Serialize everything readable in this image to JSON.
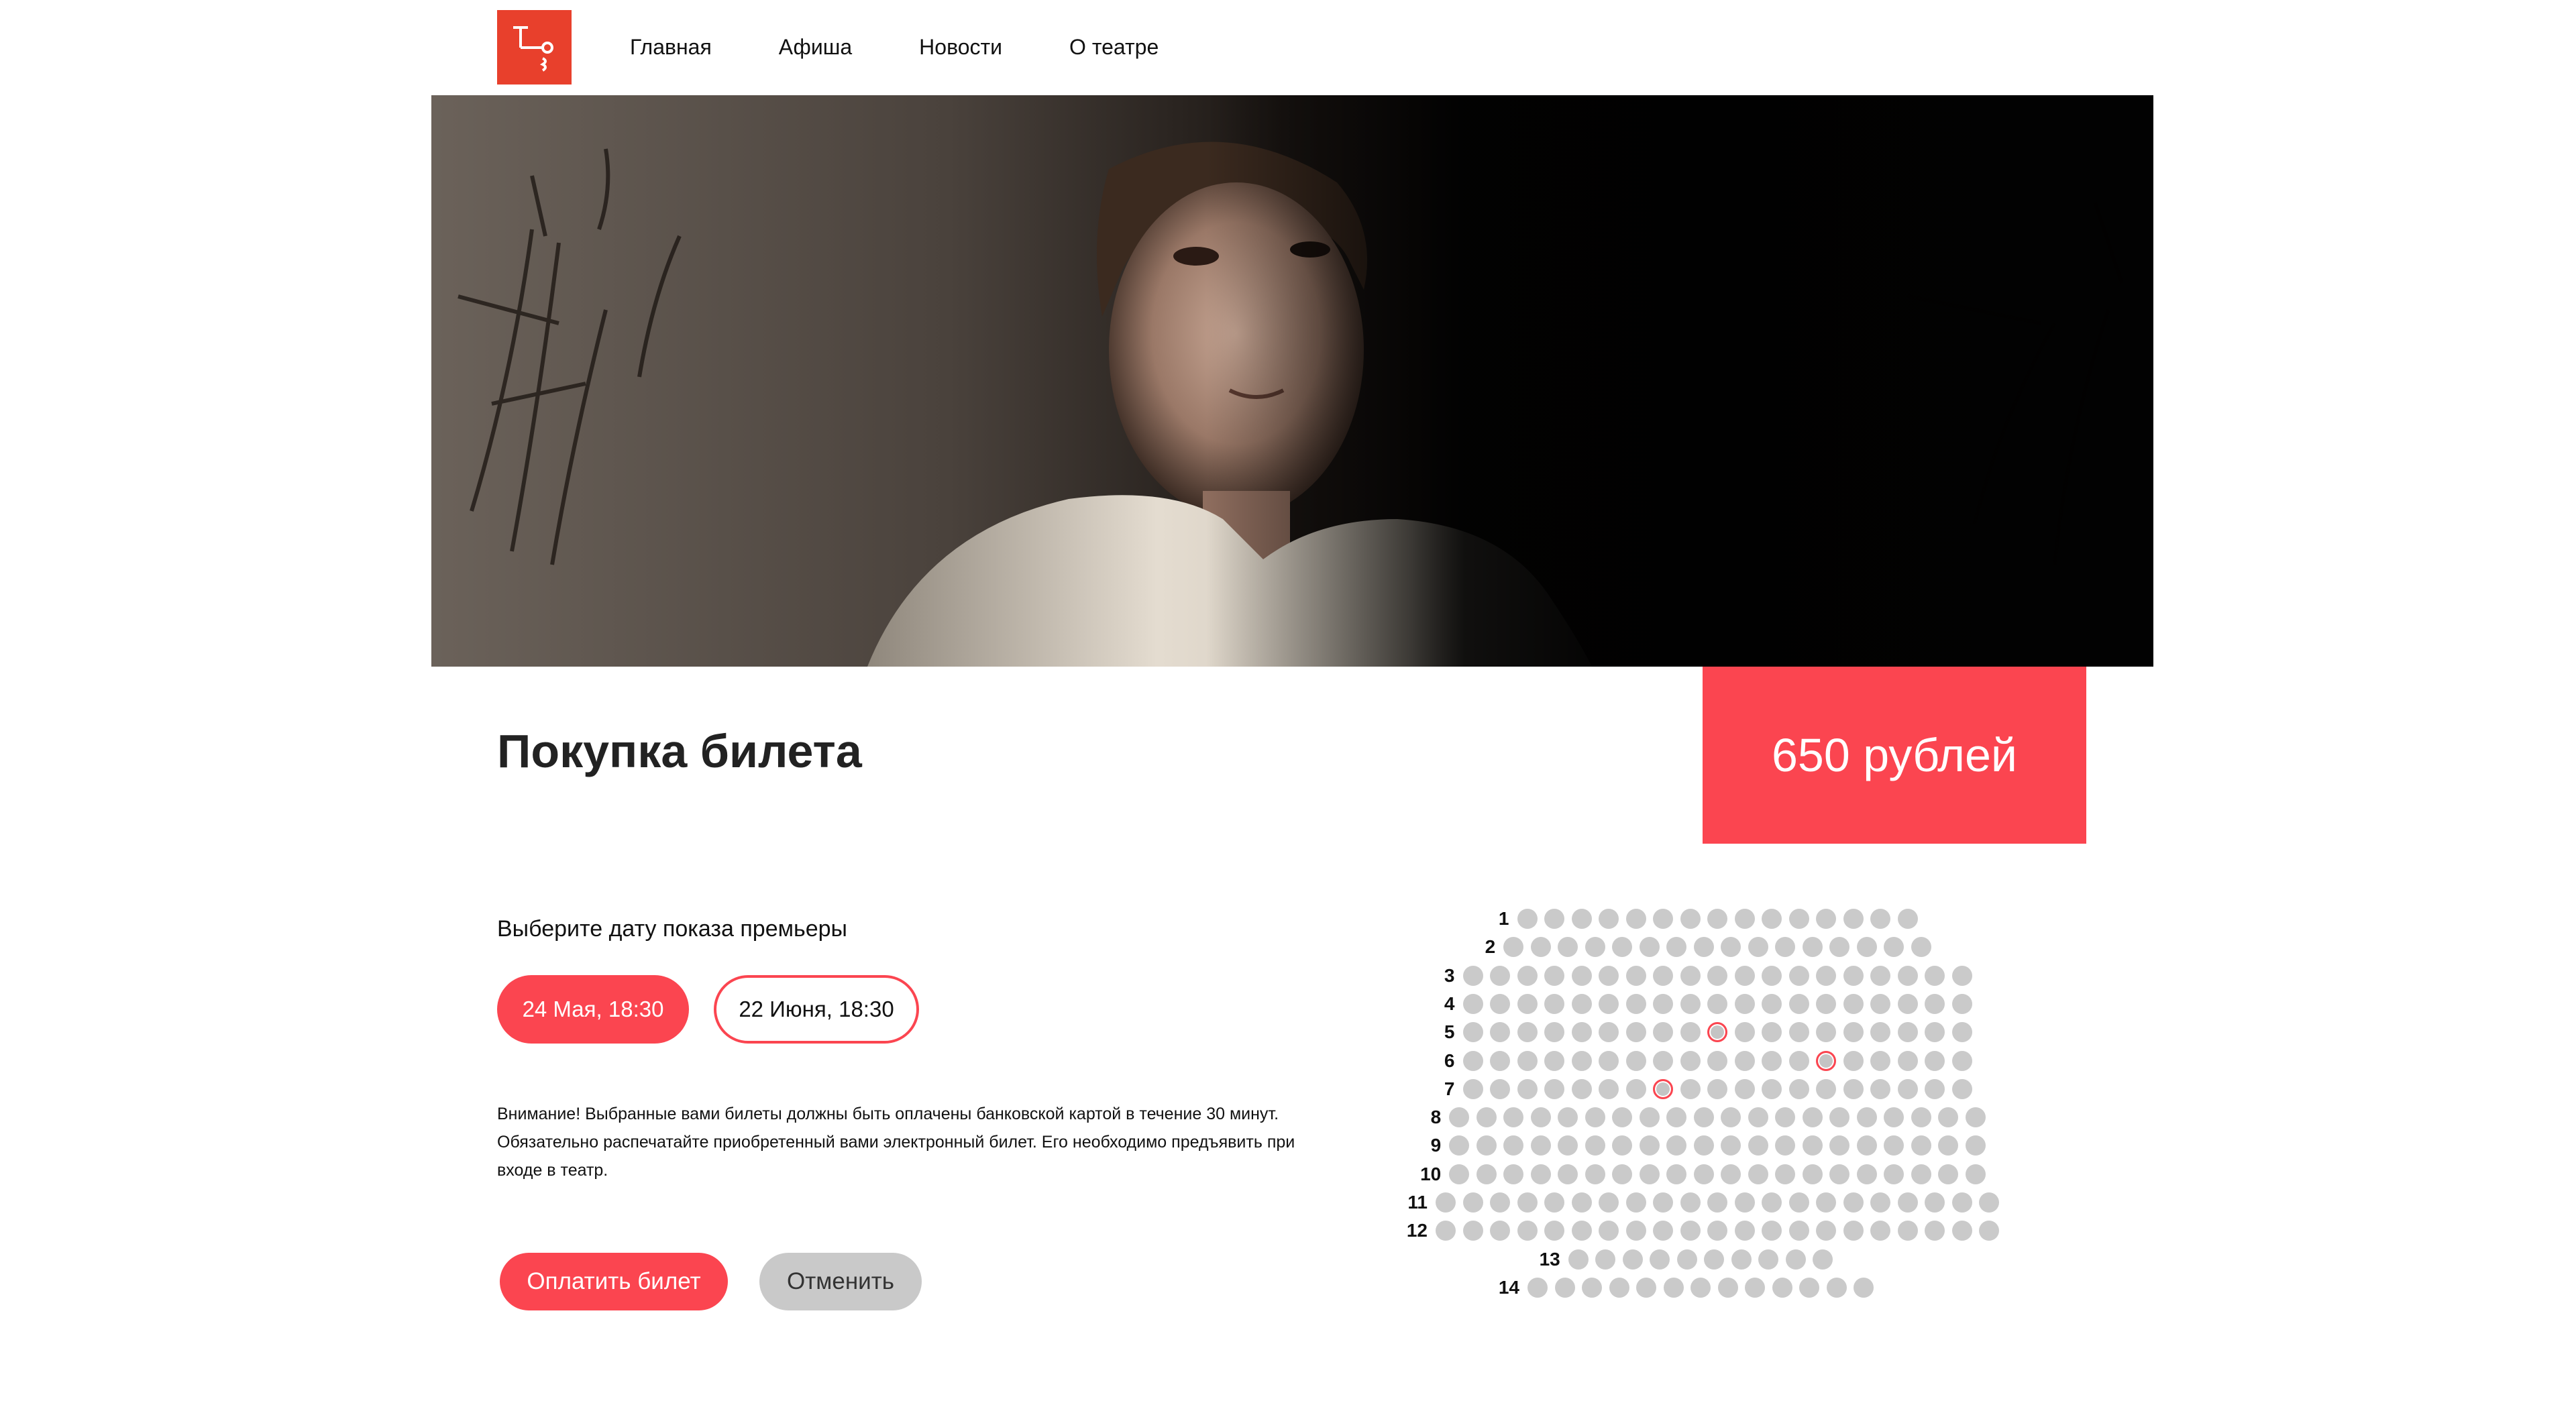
{
  "brand": {
    "logo_alt": "theatre-logo",
    "accent": "#fb4550",
    "logo_color": "#e8402c"
  },
  "nav": {
    "items": [
      {
        "label": "Главная"
      },
      {
        "label": "Афиша"
      },
      {
        "label": "Новости"
      },
      {
        "label": "О театре"
      }
    ]
  },
  "hero": {
    "image": "performance-photo"
  },
  "page": {
    "title": "Покупка билета",
    "price": "650 рублей"
  },
  "dates": {
    "prompt": "Выберите дату показа премьеры",
    "options": [
      {
        "label": "24 Мая, 18:30",
        "selected": true
      },
      {
        "label": "22 Июня, 18:30",
        "selected": false
      }
    ]
  },
  "notice": "Внимание! Выбранные вами билеты должны быть оплачены банковской картой в течение 30 минут. Обязательно распечатайте приобретенный вами электронный билет. Его необходимо предъявить при входе в театр.",
  "actions": {
    "pay_label": "Оплатить билет",
    "cancel_label": "Отменить"
  },
  "seatmap": {
    "colors": {
      "seat": "#cacaca",
      "selected_border": "#fb4550"
    },
    "rows": [
      {
        "label": "1",
        "seats": 15,
        "selected": []
      },
      {
        "label": "2",
        "seats": 16,
        "selected": []
      },
      {
        "label": "3",
        "seats": 19,
        "selected": []
      },
      {
        "label": "4",
        "seats": 19,
        "selected": []
      },
      {
        "label": "5",
        "seats": 19,
        "selected": [
          9
        ]
      },
      {
        "label": "6",
        "seats": 19,
        "selected": [
          13
        ]
      },
      {
        "label": "7",
        "seats": 19,
        "selected": [
          7
        ]
      },
      {
        "label": "8",
        "seats": 20,
        "selected": []
      },
      {
        "label": "9",
        "seats": 20,
        "selected": []
      },
      {
        "label": "10",
        "seats": 20,
        "selected": []
      },
      {
        "label": "11",
        "seats": 21,
        "selected": []
      },
      {
        "label": "12",
        "seats": 21,
        "selected": []
      },
      {
        "label": "13",
        "seats": 10,
        "selected": []
      },
      {
        "label": "14",
        "seats": 13,
        "selected": []
      }
    ]
  }
}
